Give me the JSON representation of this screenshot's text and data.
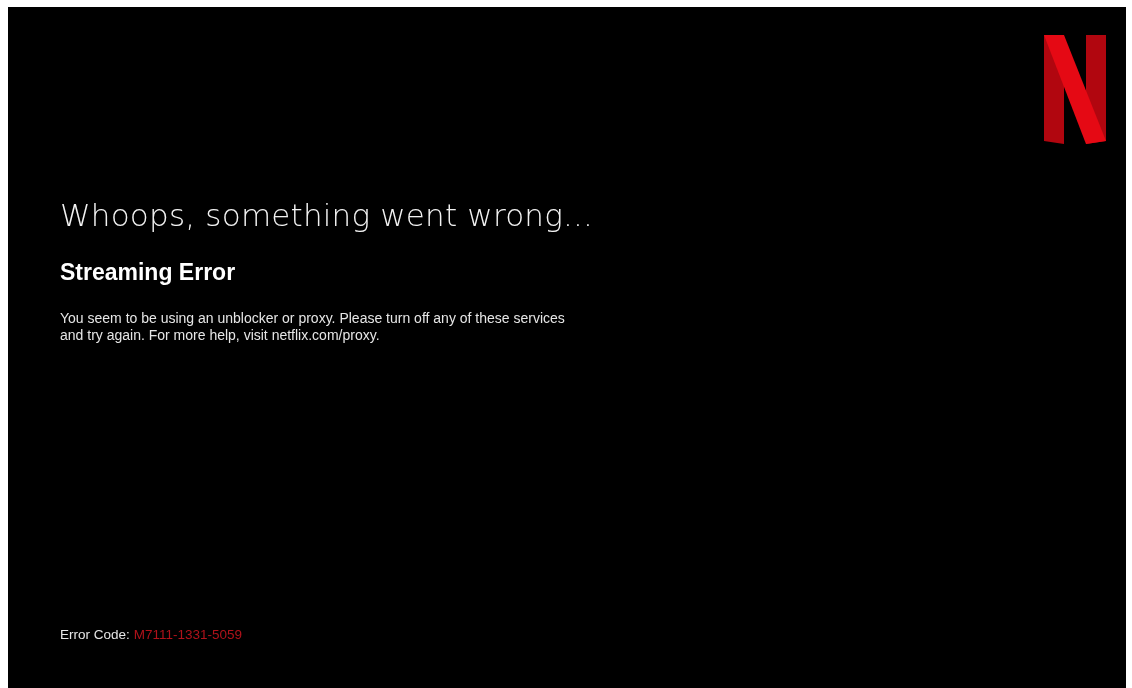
{
  "heading": "Whoops, something went wrong...",
  "error_title": "Streaming Error",
  "message": "You seem to be using an unblocker or proxy. Please turn off any of these services and try again. For more help, visit netflix.com/proxy.",
  "error_code": {
    "label": "Error Code:",
    "value": "M7111-1331-5059"
  }
}
